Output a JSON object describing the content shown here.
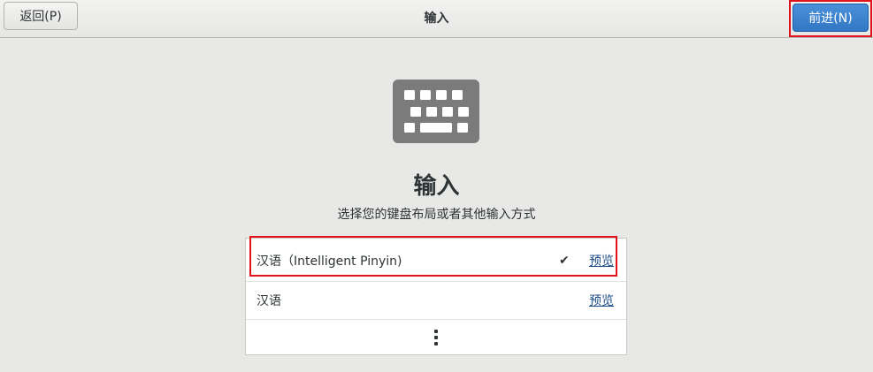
{
  "header": {
    "back_label": "返回(P)",
    "title": "输入",
    "next_label": "前进(N)"
  },
  "icon": "keyboard-icon",
  "main": {
    "title": "输入",
    "subtitle": "选择您的键盘布局或者其他输入方式"
  },
  "list": {
    "items": [
      {
        "label": "汉语（Intelligent Pinyin)",
        "selected": true,
        "preview_label": "预览"
      },
      {
        "label": "汉语",
        "selected": false,
        "preview_label": "预览"
      }
    ],
    "more_icon": "more-vertical-icon"
  },
  "colors": {
    "accent": "#3a84d0",
    "highlight": "#e0121c",
    "link": "#1d4e89"
  }
}
